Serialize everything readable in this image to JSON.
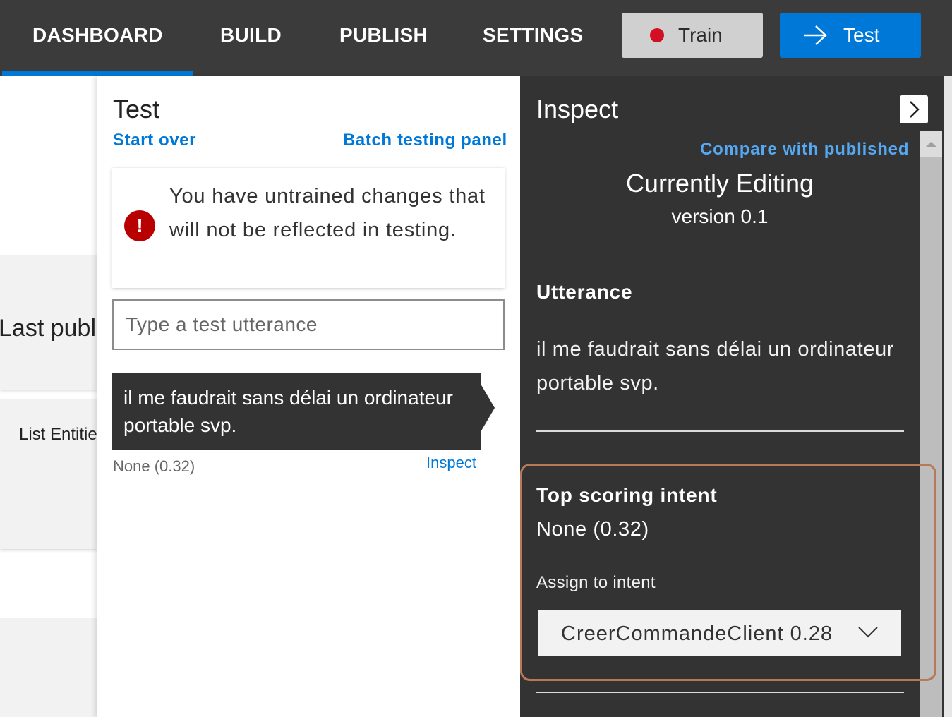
{
  "nav": {
    "items": [
      {
        "label": "DASHBOARD",
        "active": true
      },
      {
        "label": "BUILD",
        "active": false
      },
      {
        "label": "PUBLISH",
        "active": false
      },
      {
        "label": "SETTINGS",
        "active": false
      }
    ],
    "train_label": "Train",
    "test_label": "Test",
    "accent_color": "#0078d7",
    "train_status_color": "#d20f23"
  },
  "background": {
    "last_published_label": "Last publ",
    "list_entities_label": "List Entitie"
  },
  "test_panel": {
    "title": "Test",
    "start_over": "Start over",
    "batch_testing": "Batch testing panel",
    "warning": {
      "icon": "exclamation-icon",
      "text": "You have untrained changes that will not be reflected in testing."
    },
    "input_placeholder": "Type a test utterance",
    "utterance": {
      "text": "il me faudrait sans délai un ordinateur portable svp.",
      "score": "None (0.32)",
      "inspect_label": "Inspect"
    }
  },
  "inspect_panel": {
    "title": "Inspect",
    "compare_link": "Compare with published",
    "editing_label": "Currently Editing",
    "version_label": "version 0.1",
    "utterance_heading": "Utterance",
    "utterance_text": "il me faudrait sans délai un ordinateur portable svp.",
    "top_intent_heading": "Top scoring intent",
    "top_intent_value": "None (0.32)",
    "assign_label": "Assign to intent",
    "assign_selected": "CreerCommandeClient 0.28",
    "highlight_color": "#b77a59"
  }
}
